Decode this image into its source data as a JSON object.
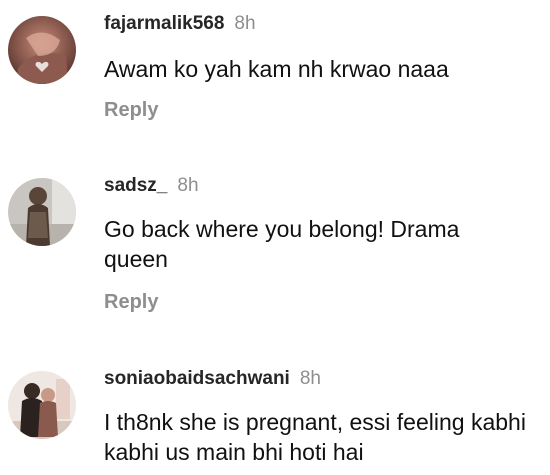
{
  "comments": [
    {
      "username": "fajarmalik568",
      "time": "8h",
      "text": "Awam ko yah kam nh krwao naaa",
      "reply_label": "Reply",
      "avatar_icon": "user-photo-hand-heart"
    },
    {
      "username": "sadsz_",
      "time": "8h",
      "text": "Go back where you belong! Drama queen",
      "reply_label": "Reply",
      "avatar_icon": "user-photo-person"
    },
    {
      "username": "soniaobaidsachwani",
      "time": "8h",
      "text": "I th8nk she is pregnant, essi feeling kabhi kabhi us main bhi hoti hai",
      "avatar_icon": "user-photo-couple"
    }
  ],
  "colors": {
    "username": "#262626",
    "meta_gray": "#8e8e8e",
    "text": "#111111"
  }
}
